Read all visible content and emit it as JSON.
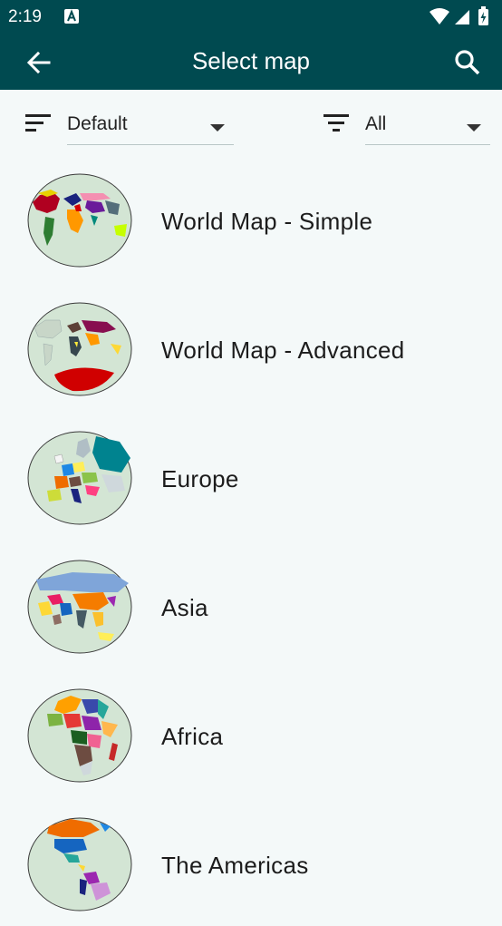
{
  "status_bar": {
    "time": "2:19",
    "notification_icon": "a-letter-icon"
  },
  "app_bar": {
    "title": "Select map"
  },
  "filters": {
    "sort_value": "Default",
    "filter_value": "All"
  },
  "maps": [
    {
      "name": "World Map - Simple"
    },
    {
      "name": "World Map - Advanced"
    },
    {
      "name": "Europe"
    },
    {
      "name": "Asia"
    },
    {
      "name": "Africa"
    },
    {
      "name": "The Americas"
    }
  ],
  "colors": {
    "primary": "#004a50",
    "background": "#f4f9f9",
    "globe_fill": "#d3e5d4"
  }
}
